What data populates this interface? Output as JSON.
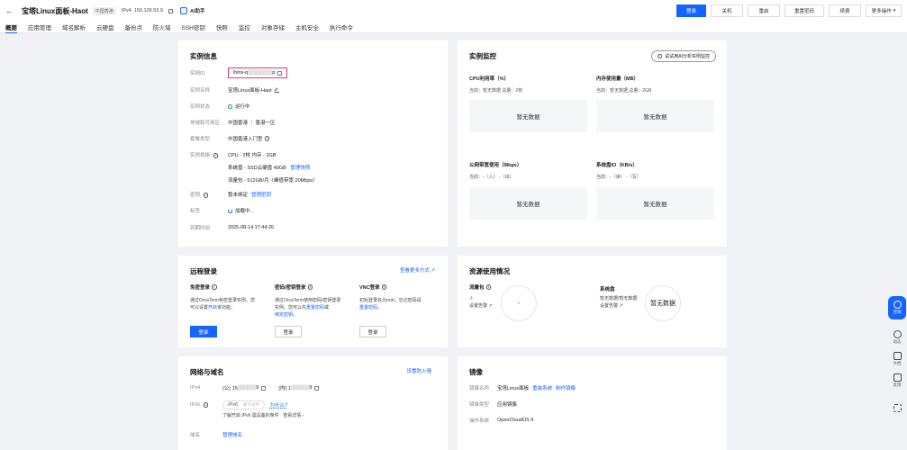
{
  "header": {
    "back_icon": "arrow-left-icon",
    "title": "宝塔Linux面板-Haot",
    "region_tag": "中国香港",
    "ipv4_label": "IPv4",
    "ipv4_value": "150.109.53.9",
    "ai_assistant": "AI助手",
    "buttons": {
      "login": "登录",
      "shutdown": "关机",
      "restart": "重启",
      "reset_password": "重置密码",
      "renew": "续费",
      "more": "更多操作"
    }
  },
  "tabs": [
    "概要",
    "应用管理",
    "域名解析",
    "云硬盘",
    "备份点",
    "防火墙",
    "SSH密钥",
    "快照",
    "监控",
    "对象存储",
    "主机安全",
    "执行命令"
  ],
  "instance_info": {
    "title": "实例信息",
    "rows": {
      "id_label": "实例ID",
      "id_prefix": "lhins-q",
      "id_mask": "▒▒▒▒▒▒▒▒",
      "id_suffix": "p",
      "name_label": "实例名称",
      "name_value": "宝塔Linux面板-Haot",
      "status_label": "实例状态",
      "status_value": "运行中",
      "region_label": "地域和可用区",
      "region_value": "中国香港 ｜ 香港一区",
      "plan_label": "套餐类型",
      "plan_value": "中国香港入门型",
      "spec_label": "实例规格",
      "spec_cpu": "CPU - 2核 内存 - 2GB",
      "spec_disk": "系统盘 - SSD云硬盘 40GB",
      "spec_snapshot_link": "管理快照",
      "spec_traffic": "流量包 - 512GB/月（峰值带宽 20Mbps）",
      "key_label": "密钥",
      "key_value": "暂未绑定",
      "key_link": "管理密钥",
      "tag_label": "标签",
      "tag_value": "加载中...",
      "expire_label": "到期时间",
      "expire_value": "2025-08-14 17:44:26"
    }
  },
  "monitoring": {
    "title": "实例监控",
    "ai_button": "试试用AI分析实例监控",
    "cpu_title": "CPU利用率（%）",
    "cpu_sub": "当前：暂无数据 总量：2核",
    "mem_title": "内存使用量（MB）",
    "mem_sub": "当前：暂无数据 总量：2GB",
    "net_title": "公网带宽使用（Mbps）",
    "net_sub": "当前：-（入） -（出）",
    "disk_title": "系统盘IO（KB/s）",
    "disk_sub": "当前：-（读） -（写）",
    "no_data": "暂无数据"
  },
  "remote_login": {
    "title": "远程登录",
    "more_link": "查看更多方式",
    "pw_free_title": "免密登录",
    "pw_free_desc_1": "通过OrcaTerm免密登录实例。您",
    "pw_free_desc_2a": "可以设置",
    "pw_free_desc_2b": "开启",
    "pw_free_desc_2c": "该功能。",
    "pw_title": "密码/密钥登录",
    "pw_desc_1": "通过OrcaTerm使用密码/密钥登录",
    "pw_desc_2a": "实例。您可以先",
    "pw_desc_2b": "重置密码",
    "pw_desc_2c": "或",
    "pw_desc_3a": "绑定密钥",
    "pw_desc_3b": "。",
    "vnc_title": "VNC登录",
    "vnc_desc_1": "初始登录名为root，忘记密码请",
    "vnc_desc_2a": "重置密码",
    "vnc_desc_2b": "。",
    "login_label": "登录"
  },
  "resource_usage": {
    "title": "资源使用情况",
    "traffic_title": "流量包",
    "traffic_value": "-/-",
    "traffic_link": "设置告警",
    "traffic_circle": "-",
    "disk_title": "系统盘",
    "disk_value": "暂无数据/暂无数据",
    "disk_link": "设置告警",
    "disk_circle": "暂无数据"
  },
  "network": {
    "title": "网络与域名",
    "firewall_link": "设置防火墙",
    "ipv4_label": "IPv4",
    "public_prefix": "(公) 15",
    "public_mask": "▒▒▒▒▒▒",
    "public_suffix": "9",
    "private_prefix": "(内) 1",
    "private_mask": "▒▒▒▒▒▒",
    "private_suffix": "9",
    "ipv6_label": "IPv6",
    "ipv6_tag": "IPv6",
    "ipv6_sub": "暂不支持",
    "ipv6_why": "为什么?",
    "ipv6_note": "了解开启 IPv6 需具备的条件",
    "ipv6_more": "查看详情",
    "domain_label": "域名",
    "domain_link": "管理域名"
  },
  "image": {
    "title": "镜像",
    "name_label": "镜像名称",
    "name_value": "宝塔Linux面板",
    "reinstall_link": "重装系统",
    "make_link": "制作镜像",
    "type_label": "镜像类型",
    "type_value": "应用镜像",
    "os_label": "操作系统",
    "os_value": "OpenCloudOS 9"
  },
  "sidebar": {
    "consult": "咨询",
    "news": "动态",
    "docs": "文档",
    "feedback": "反馈"
  }
}
